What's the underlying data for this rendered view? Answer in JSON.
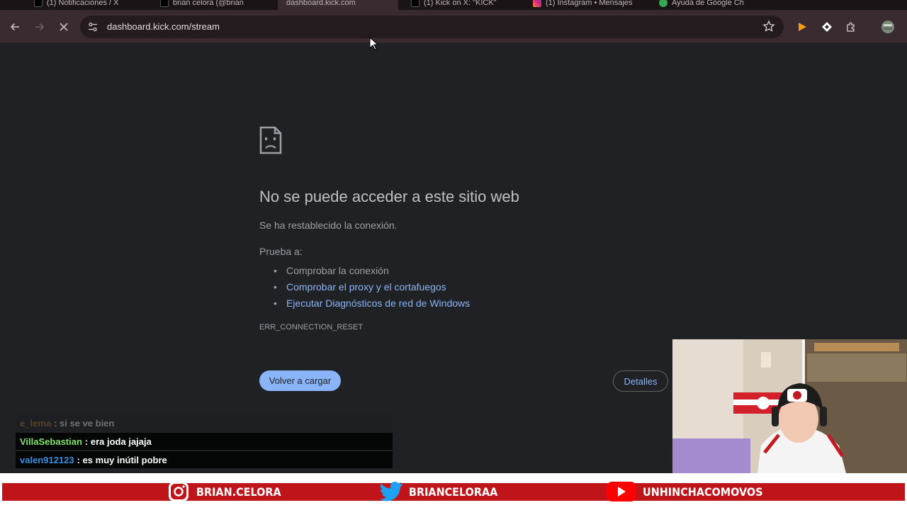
{
  "browser": {
    "tabs": [
      {
        "label": "(1) Notificaciones / X",
        "active": false
      },
      {
        "label": "brian celora (@brian",
        "active": false
      },
      {
        "label": "dashboard.kick.com",
        "active": true
      },
      {
        "label": "(1) Kick on X: \"KICK\"",
        "active": false
      },
      {
        "label": "(1) Instagram • Mensajes",
        "active": false
      },
      {
        "label": "Ayuda de Google Ch",
        "active": false
      }
    ],
    "url": "dashboard.kick.com/stream",
    "icons": {
      "back": "arrow-left-icon",
      "forward": "arrow-right-icon",
      "stop": "close-icon",
      "site_info": "tune-icon",
      "bookmark": "star-icon",
      "extensions": [
        "play-icon",
        "diamond-icon",
        "puzzle-icon",
        "profile-icon"
      ]
    }
  },
  "error_page": {
    "title": "No se puede acceder a este sitio web",
    "subtitle": "Se ha restablecido la conexión.",
    "try_label": "Prueba a:",
    "suggestions": [
      {
        "text": "Comprobar la conexión",
        "link": false
      },
      {
        "text": "Comprobar el proxy y el cortafuegos",
        "link": true
      },
      {
        "text": "Ejecutar Diagnósticos de red de Windows",
        "link": true
      }
    ],
    "error_code": "ERR_CONNECTION_RESET",
    "reload_label": "Volver a cargar",
    "details_label": "Detalles"
  },
  "chat": [
    {
      "user": "e_lema",
      "text": ": si se ve bien",
      "color": "#c47a2c",
      "faded": true
    },
    {
      "user": "VillaSebastian",
      "text": ": era joda jajaja",
      "color": "#7fe36b",
      "faded": false
    },
    {
      "user": "valen912123",
      "text": ": es muy inútil pobre",
      "color": "#3a8fe0",
      "faded": false
    }
  ],
  "socials": [
    {
      "icon": "instagram-icon",
      "handle": "BRIAN.CELORA"
    },
    {
      "icon": "twitter-icon",
      "handle": "BRIANCELORAA"
    },
    {
      "icon": "youtube-icon",
      "handle": "UNHINCHACOMOVOS"
    }
  ],
  "colors": {
    "page_bg": "#202124",
    "toolbar_bg": "#3a2b30",
    "link": "#8ab4f8",
    "banner_red": "#c0141b"
  }
}
